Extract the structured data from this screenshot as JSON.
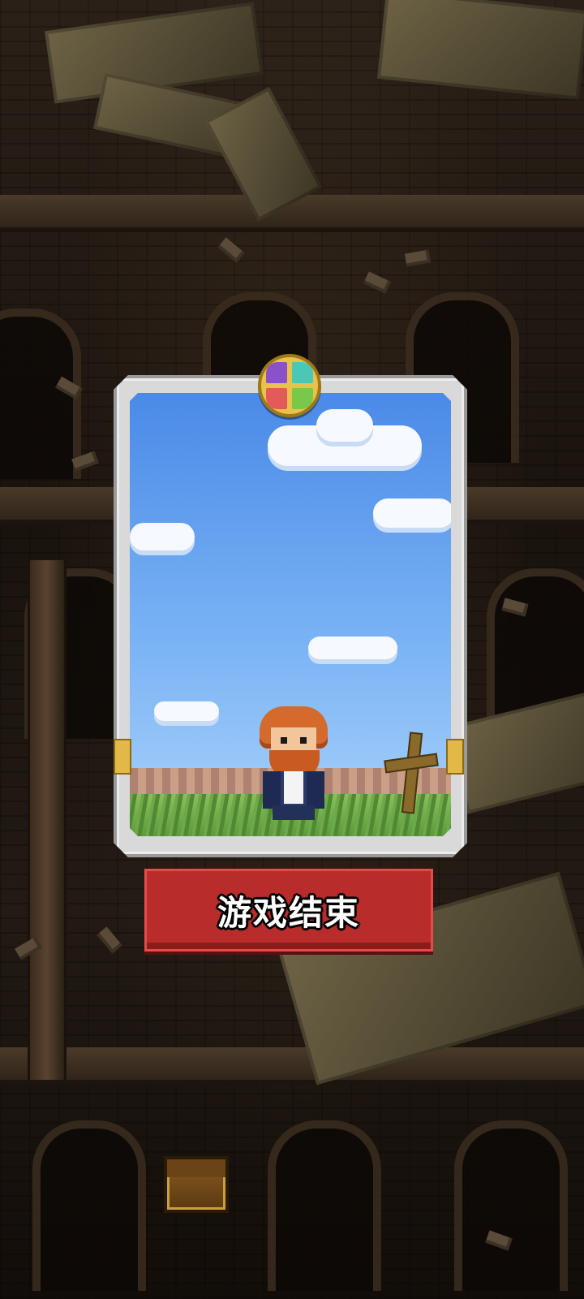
{
  "screen": {
    "name": "game-over-screen"
  },
  "card": {
    "badge_icon": "gem-compass-icon",
    "sky_color": "#4a8ae8",
    "character": "red-bearded-hero",
    "grave_marker": "wooden-cross"
  },
  "game_over_button": {
    "label": "游戏结束",
    "color": "#b82c2c"
  },
  "background": {
    "theme": "ruined-brick-tower",
    "treasure_icon": "treasure-chest-icon"
  }
}
